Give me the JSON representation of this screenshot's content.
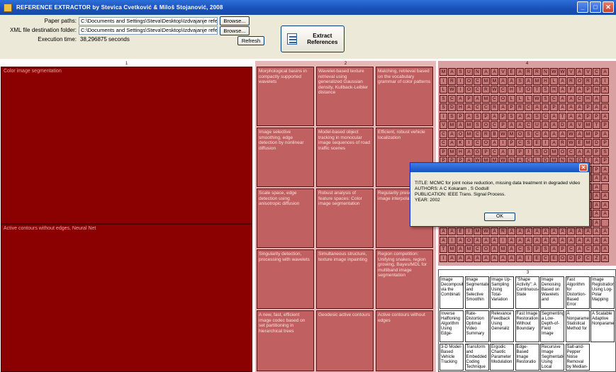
{
  "window": {
    "title": "REFERENCE EXTRACTOR by Stevica Cvetković & Miloš Stojanović, 2008",
    "minimize": "_",
    "maximize": "□",
    "close": "✕"
  },
  "form": {
    "paper_paths_label": "Paper paths:",
    "paper_paths_value": "C:\\Documents and Settings\\Steva\\Desktop\\Izdvajanje refere",
    "xml_label": "XML file destination folder:",
    "xml_value": "C:\\Documents and Settings\\Steva\\Desktop\\Izdvajanje refere",
    "execution_label": "Execution time:",
    "execution_value": "38,296875 seconds",
    "browse1": "Browse...",
    "browse2": "Browse...",
    "refresh": "Refresh",
    "extract": "Extract References"
  },
  "left_panel": {
    "header": "1",
    "box1_caption": "Color image segmentation",
    "box2_caption": "Active contours without edges, Neural Net"
  },
  "mid_panel": {
    "header": "2",
    "cells": [
      "Morphological basins in compactly supported wavelets",
      "Wavelet-based texture retrieval using generalized Gaussian density, Kullback-Leibler distance",
      "Matching, retrieval based on the vocabulary grammar of color patterns",
      "Image selective smoothing, edge detection by nonlinear diffusion",
      "Model-based object tracking in monocular image sequences of road traffic scenes",
      "Efficient, robust vehicle localization",
      "Scale space, edge detection using anisotropic diffusion",
      "Robust analysis of feature spaces: Color image segmentation",
      "Regularity preserving image interpolation",
      "Singularity detection, processing with wavelets",
      "Simultaneous structure, texture image inpainting",
      "Region competition: Unifying snakes, region growing, Bayes/MDL for multiband image segmentation",
      "A new, fast, efficient image codec based on set partitioning in hierarchical trees",
      "Geodesic active contours",
      "Active contours without edges"
    ]
  },
  "right_panel": {
    "header": "4",
    "rows": [
      "MASUNAAVEARRNWWVAVCA",
      "IRIOCMMAASAMHLARORAI",
      "LWIOCRWCHTOTSHAFAPHA",
      "SCAPAMCOLLLWSCAACHA",
      "SDHACCRAPRCAAPAAAPAA",
      "ISPASPAPSAASCATAAPPA",
      "VMAMSOCPAACUAADAVMTP",
      "CAOMCRBWMOSCAAAWAMPA",
      "CAKICOAIPCSEIARWEMDP",
      "PMHAGPCAIPISOMOCAAPS",
      "PPPAWMMWNACLDMNNDTAP",
      "DAPOOMONIVOSIGEDCLPA",
      "AAAPPAIAAIAAAAAAAAAA",
      "AAPAIAPAAAAAAAAAAAA",
      "AAAAAAAAAAAAAAAAAAAA",
      "AAAAAPAAAAAAAAAAAAAA",
      "AAPAAAAAAAAAAAAAAAAA",
      "AAAAAAAAAAAAAAAAAAA",
      "AAEIMWARAAAAAAAAAAAA",
      "AIAOAAAIAAAAAAAAAAAA",
      "TMAMCOAMACSPSAPCACAA",
      "IAAAAAAAAAIECEODPCZA"
    ]
  },
  "bottom_right_panel": {
    "header": "3",
    "cells": [
      "Image Decomposition via the Combinati",
      "Image Segmentation and Selective Smoothin",
      "Image Up-Sampling Using Total-Variation",
      "\"Shape Activity\": A Continuous-State",
      "Image Denoising Based on Wavelets and",
      "Fast Algorithm for Distortion-Based Error",
      "Image Registration Using Log-Polar Mapping",
      "Inverse Halftoning Algorithm Using Edge-",
      "Rate-Distortion Optimal Video Summary",
      "Relevance Feedback Using Generaliz",
      "Fast Image Restoration Without Boundary",
      "Segmenting a Low-Depth-of-Field Image",
      "A Nonparametric Statistical Method for",
      "A Scalable Adaptive Nonparametric",
      "3-D Model-Based Vehicle Tracking",
      "Transform and Embedded Coding Technique",
      "Ergodic Chaotic Parameter Modulation",
      "Edge-Based Image Restoratio",
      "Recursive Image Segmentation Using Local",
      "Salt-and-Pepper Noise Removal by Median-Type"
    ]
  },
  "dialog": {
    "close": "✕",
    "title_line": "TITLE: MCMC for joint noise reduction, missing data treatment in degraded video",
    "authors_line": "AUTHORS: A C Kokaram , S Godsill",
    "publication_line": "PUBLICATION: IEEE Trans. Signal Process.",
    "year_line": "YEAR: 2002",
    "ok": "OK"
  }
}
